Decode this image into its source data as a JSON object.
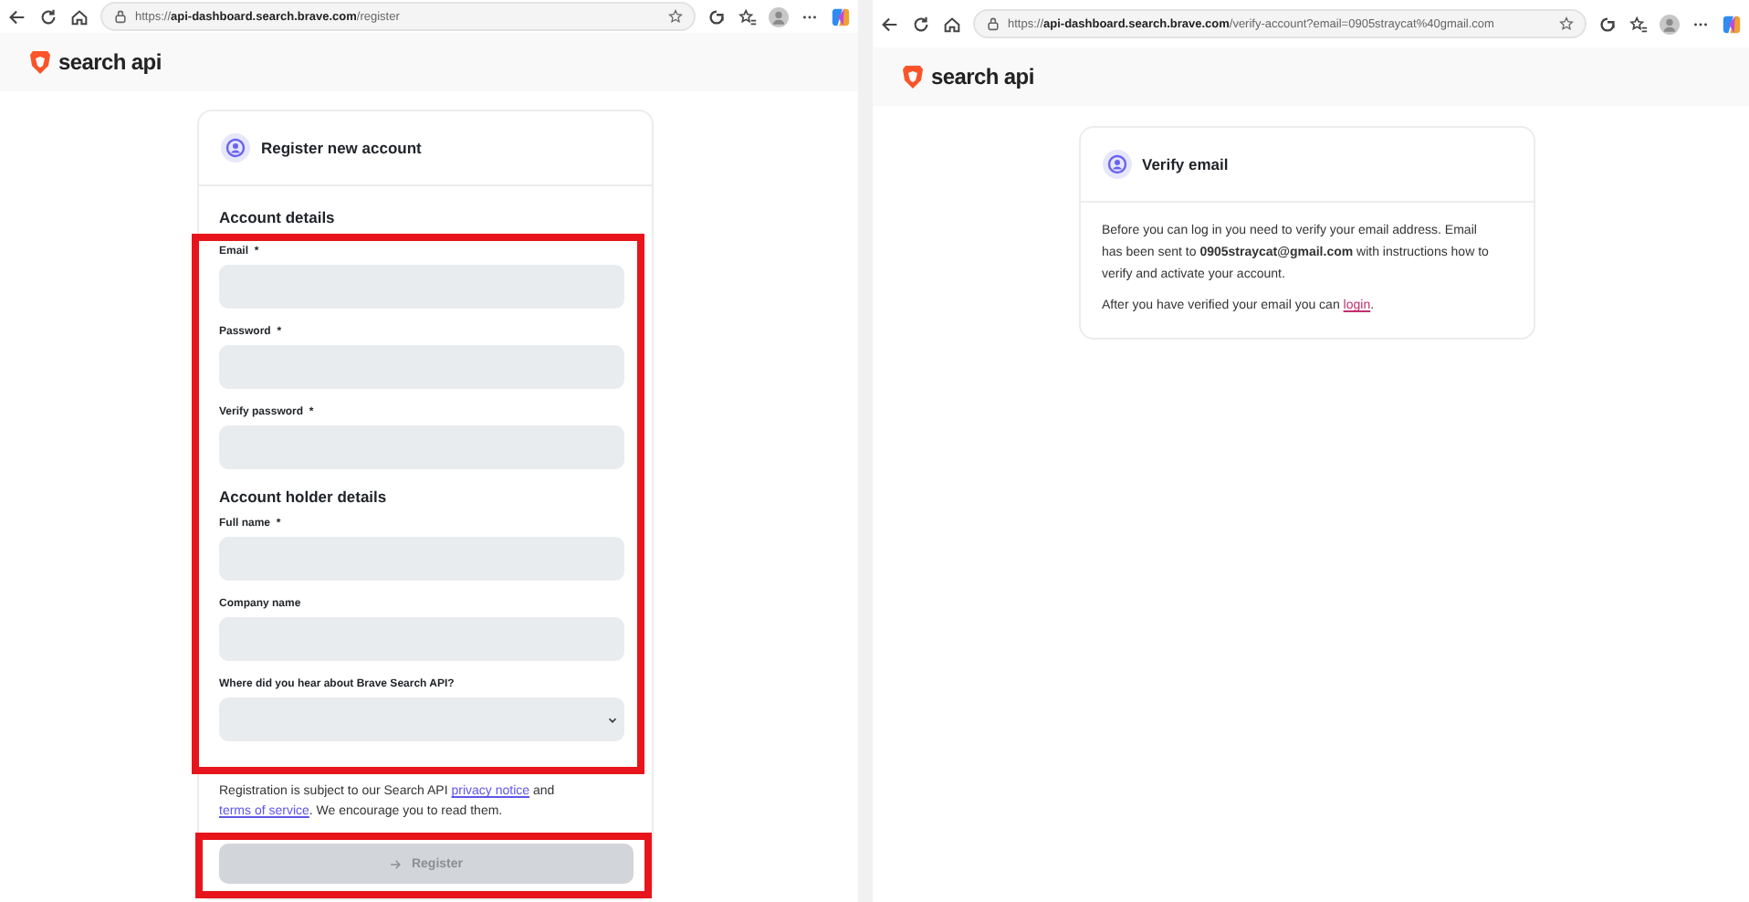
{
  "register_window": {
    "browser": {
      "url": "https://**api-dashboard.search.brave.com**/register"
    },
    "brand": "search api",
    "card": {
      "title": "Register new account",
      "sections": [
        {
          "heading": "Account details",
          "fields": [
            {
              "label": "Email",
              "required_mark": "*",
              "kind": "text"
            },
            {
              "label": "Password",
              "required_mark": "*",
              "kind": "text"
            },
            {
              "label": "Verify password",
              "required_mark": "*",
              "kind": "text"
            }
          ]
        },
        {
          "heading": "Account holder details",
          "fields": [
            {
              "label": "Full name",
              "required_mark": "*",
              "kind": "text"
            },
            {
              "label": "Company name",
              "kind": "text"
            },
            {
              "label": "Where did you hear about Brave Search API?",
              "kind": "select"
            }
          ]
        }
      ],
      "fields_highlighted": true,
      "notice": {
        "before": "Registration is subject to our Search API",
        "link1": "privacy notice",
        "middle": "and",
        "link2": "terms of service",
        "after": ". We encourage you to read them."
      },
      "submit": {
        "label": "Register",
        "disabled": true,
        "highlighted": true
      }
    }
  },
  "verify_window": {
    "browser": {
      "url": "https://**api-dashboard.search.brave.com**/verify-account?email=0905straycat%40gmail.com"
    },
    "brand": "search api",
    "card": {
      "title": "Verify email",
      "message": "Before you can log in you need to verify your email address. Email has been sent to **0905straycat@gmail.com** with instructions how to verify and activate your account.",
      "followup": {
        "text": "After you have verified your email you can",
        "link": "login",
        "end": "."
      }
    }
  }
}
